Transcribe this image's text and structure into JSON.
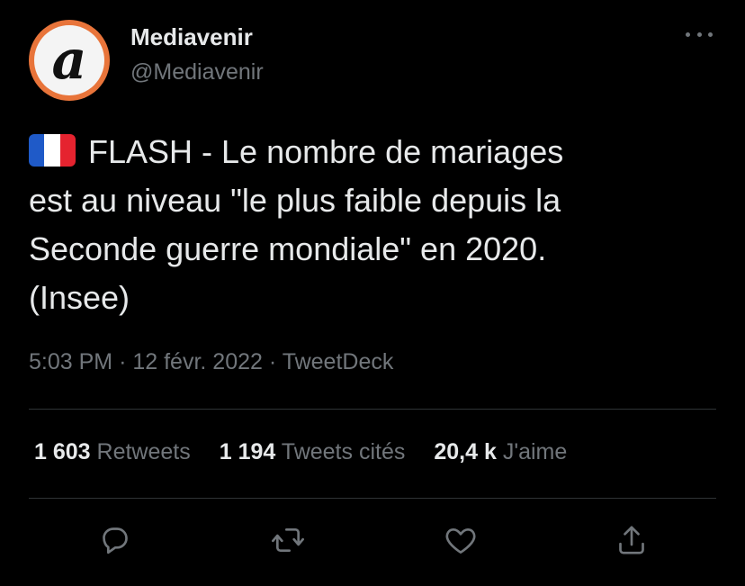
{
  "tweet": {
    "author": {
      "display_name": "Mediavenir",
      "handle": "@Mediavenir",
      "avatar_letter": "a",
      "avatar_colors": {
        "ring": "#e8743a",
        "inner": "#f4f4f4"
      }
    },
    "flag": {
      "emoji_name": "france-flag",
      "colors": [
        "#1f5ac8",
        "#ffffff",
        "#e5232f"
      ]
    },
    "text_lines": [
      "FLASH - Le nombre de mariages",
      "est au niveau \"le plus faible depuis la",
      "Seconde guerre mondiale\" en 2020.",
      "(Insee)"
    ],
    "time": "5:03 PM",
    "date": "12 févr. 2022",
    "source": "TweetDeck",
    "stats": {
      "retweets_count": "1 603",
      "retweets_label": "Retweets",
      "quotes_count": "1 194",
      "quotes_label": "Tweets cités",
      "likes_count": "20,4 k",
      "likes_label": "J'aime"
    },
    "actions": [
      {
        "name": "reply-icon"
      },
      {
        "name": "retweet-icon"
      },
      {
        "name": "like-icon"
      },
      {
        "name": "share-icon"
      }
    ]
  },
  "colors": {
    "background": "#000000",
    "primary_text": "#e7e9ea",
    "secondary_text": "#71767b",
    "divider": "#2f3336"
  }
}
